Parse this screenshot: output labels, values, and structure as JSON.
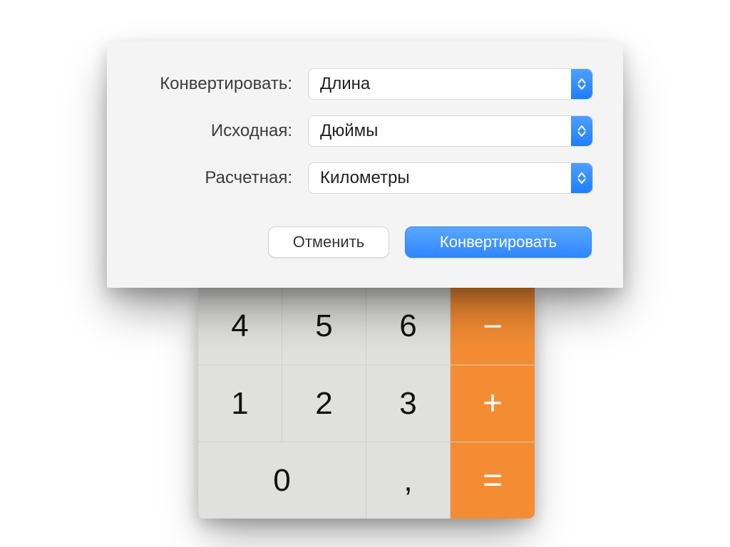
{
  "dialog": {
    "fields": {
      "convert": {
        "label": "Конвертировать:",
        "value": "Длина"
      },
      "from": {
        "label": "Исходная:",
        "value": "Дюймы"
      },
      "to": {
        "label": "Расчетная:",
        "value": "Километры"
      }
    },
    "buttons": {
      "cancel": "Отменить",
      "convert": "Конвертировать"
    }
  },
  "calculator": {
    "rows": [
      {
        "cells": [
          "4",
          "5",
          "6"
        ],
        "op": "−"
      },
      {
        "cells": [
          "1",
          "2",
          "3"
        ],
        "op": "+"
      }
    ],
    "lastRow": {
      "zero": "0",
      "comma": ",",
      "op": "="
    }
  },
  "colors": {
    "accent": "#2f86ff",
    "operator": "#f48c33"
  }
}
